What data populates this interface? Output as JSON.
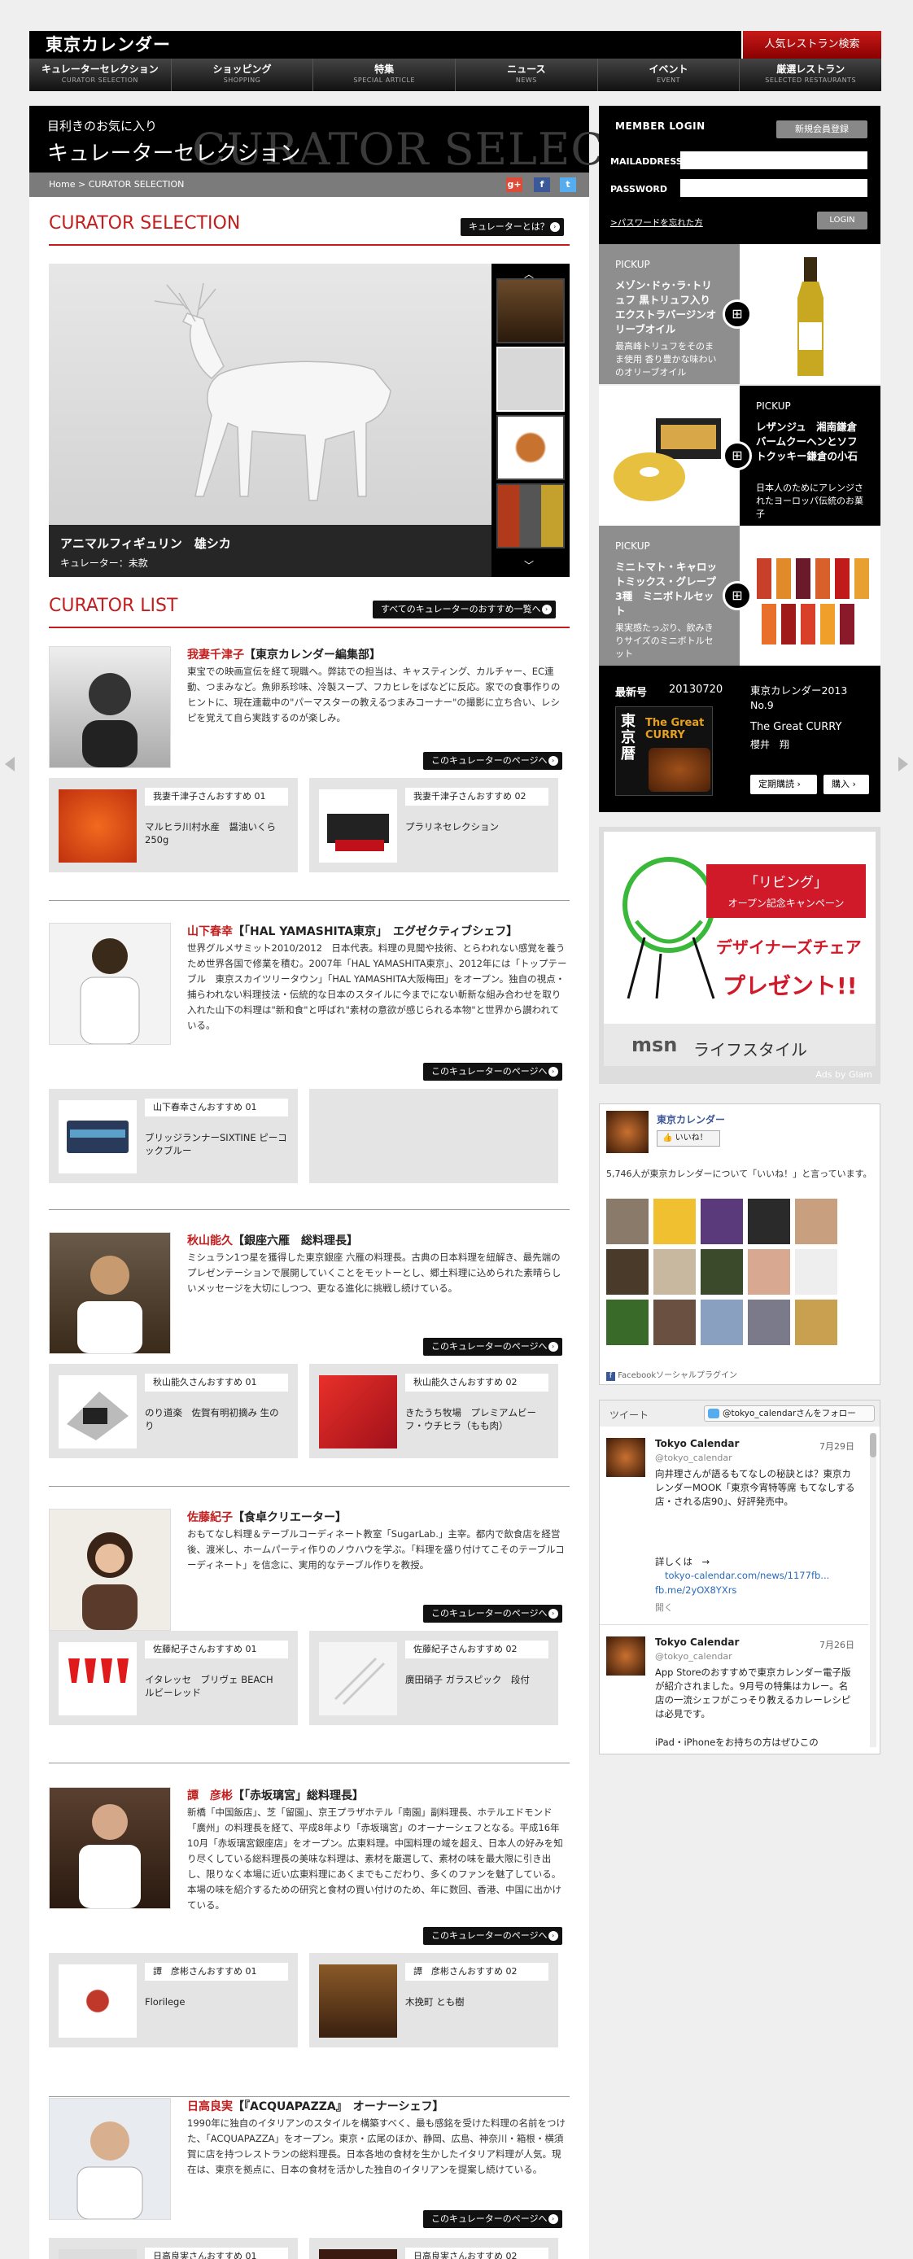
{
  "header": {
    "brand": "東京カレンダー",
    "restaurant_search": "人気レストラン検索"
  },
  "nav": [
    {
      "jp": "キュレーターセレクション",
      "en": "CURATOR SELECTION"
    },
    {
      "jp": "ショッピング",
      "en": "SHOPPING"
    },
    {
      "jp": "特集",
      "en": "SPECIAL ARTICLE"
    },
    {
      "jp": "ニュース",
      "en": "NEWS"
    },
    {
      "jp": "イベント",
      "en": "EVENT"
    },
    {
      "jp": "厳選レストラン",
      "en": "SELECTED RESTAURANTS"
    }
  ],
  "hero": {
    "sub": "目利きのお気に入り",
    "title": "キュレーターセレクション",
    "bg": "CURATOR SELECTION",
    "breadcrumb": "Home > CURATOR SELECTION"
  },
  "section1": {
    "title": "CURATOR SELECTION",
    "button": "キュレーターとは？"
  },
  "slide": {
    "name": "アニマルフィギュリン　雄シカ",
    "curator": "キュレーター：未款"
  },
  "section2": {
    "title": "CURATOR LIST",
    "button": "すべてのキュレーターのおすすめ一覧へ"
  },
  "curator_page_button": "このキュレーターのページへ",
  "curators": [
    {
      "name": "我妻千津子",
      "role": "【東京カレンダー編集部】",
      "bio": "東宝での映画宣伝を経て現職へ。弊誌での担当は、キャスティング、カルチャー、EC連動、つまみなど。魚卵系珍味、冷製スープ、フカヒレをばなどに反応。家での食事作りのヒントに、現在連載中の\"パーマスターの教えるつまみコーナー\"の撮影に立ち合い、レシピを覚えて自ら実践するのが楽しみ。",
      "recs": [
        {
          "tag": "我妻千津子さんおすすめ 01",
          "title": "マルヒラ川村水産　醤油いくら　250g"
        },
        {
          "tag": "我妻千津子さんおすすめ 02",
          "title": "プラリネセレクション"
        }
      ]
    },
    {
      "name": "山下春幸",
      "role": "【「HAL YAMASHITA東京」　エグゼクティブシェフ】",
      "bio": "世界グルメサミット2010/2012　日本代表。料理の見聞や技術、とらわれない感覚を養うため世界各国で修業を積む。2007年「HAL YAMASHITA東京」、2012年には「トップテーブル　東京スカイツリータウン」「HAL YAMASHITA大阪梅田」をオープン。独自の視点・捕らわれない料理技法・伝統的な日本のスタイルに今までにない斬新な組み合わせを取り入れた山下の料理は\"新和食\"と呼ばれ\"素材の意欲が感じられる本物\"と世界から讃われている。",
      "recs": [
        {
          "tag": "山下春幸さんおすすめ 01",
          "title": "ブリッジランナーSIXTINE ピーコックブルー"
        }
      ]
    },
    {
      "name": "秋山能久",
      "role": "【銀座六雁　総料理長】",
      "bio": "ミシュラン1つ星を獲得した東京銀座 六雁の料理長。古典の日本料理を紐解き、最先端のプレゼンテーションで展開していくことをモットーとし、郷土料理に込められた素晴らしいメッセージを大切にしつつ、更なる進化に挑戦し続けている。",
      "recs": [
        {
          "tag": "秋山能久さんおすすめ 01",
          "title": "のり道楽　佐賀有明初摘み 生のり"
        },
        {
          "tag": "秋山能久さんおすすめ 02",
          "title": "きたうち牧場　プレミアムビーフ・ウチヒラ（もも肉）"
        }
      ]
    },
    {
      "name": "佐藤紀子",
      "role": "【食卓クリエーター】",
      "bio": "おもてなし料理＆テーブルコーディネート教室「SugarLab.」主宰。都内で飲食店を経営後、渡米し、ホームパーティ作りのノウハウを学ぶ。「料理を盛り付けてこそのテーブルコーディネート」を信念に、実用的なテーブル作りを教授。",
      "recs": [
        {
          "tag": "佐藤紀子さんおすすめ 01",
          "title": "イタレッセ　ブリヴェ BEACH　ルビーレッド"
        },
        {
          "tag": "佐藤紀子さんおすすめ 02",
          "title": "廣田硝子 ガラスピック　段付"
        }
      ]
    },
    {
      "name": "譚　彦彬",
      "role": "【「赤坂璃宮」総料理長】",
      "bio": "新橋「中国飯店」、芝「留園」、京王プラザホテル「南園」副料理長、ホテルエドモンド「廣州」の料理長を経て、平成8年より「赤坂璃宮」のオーナーシェフとなる。平成16年10月「赤坂璃宮銀座店」をオープン。広東料理。中国料理の域を超え、日本人の好みを知り尽くしている総料理長の美味な料理は、素材を厳選して、素材の味を最大限に引き出し、限りなく本場に近い広東料理にあくまでもこだわり、多くのファンを魅了している。本場の味を紹介するための研究と食材の買い付けのため、年に数回、香港、中国に出かけている。",
      "recs": [
        {
          "tag": "譚　彦彬さんおすすめ 01",
          "title": "Florilege"
        },
        {
          "tag": "譚　彦彬さんおすすめ 02",
          "title": "木挽町 とも樹"
        }
      ]
    },
    {
      "name": "日高良実",
      "role": "【『ACQUAPAZZA』　オーナーシェフ】",
      "bio": "1990年に独自のイタリアンのスタイルを構築すべく、最も感銘を受けた料理の名前をつけた、「ACQUAPAZZA」をオープン。東京・広尾のほか、静岡、広島、神奈川・箱根・横須賀に店を持つレストランの総料理長。日本各地の食材を生かしたイタリア料理が人気。現在は、東京を拠点に、日本の食材を活かした独自のイタリアンを提案し続けている。",
      "recs": [
        {
          "tag": "日高良実さんおすすめ 01",
          "title": ""
        },
        {
          "tag": "日高良実さんおすすめ 02",
          "title": ""
        }
      ]
    }
  ],
  "login": {
    "title": "MEMBER LOGIN",
    "register": "新規会員登録",
    "mail": "MAILADDRESS",
    "password": "PASSWORD",
    "forgot": ">パスワードを忘れた方",
    "login_btn": "LOGIN"
  },
  "picks": [
    {
      "kicker": "PICKUP",
      "title": "メゾン･ドゥ･ラ･トリュフ 黒トリュフ入りエクストラバージンオリーブオイル",
      "desc": "最高峰トリュフをそのまま使用 香り豊かな味わいのオリーブオイル"
    },
    {
      "kicker": "PICKUP",
      "title": "レザンジュ　湘南鎌倉バームクーヘンとソフトクッキー鎌倉の小石",
      "desc": "日本人のためにアレンジされたヨーロッパ伝統のお菓子"
    },
    {
      "kicker": "PICKUP",
      "title": "ミニトマト・キャロットミックス・グレープ3種　ミニボトルセット",
      "desc": "果実感たっぷり、飲みきりサイズのミニボトルセット"
    }
  ],
  "latest": {
    "label": "最新号",
    "issue": "20130720",
    "mag": "東京カレンダー2013 No.9",
    "title": "The Great CURRY",
    "editor": "櫻井　翔",
    "subscribe": "定期購読",
    "buy": "購入",
    "cover_title": "東京暦",
    "cover_sub": "The Great CURRY"
  },
  "ad": {
    "badge1": "「リビング」",
    "badge2": "オープン記念キャンペーン",
    "line1": "デザイナーズチェア",
    "line2": "プレゼント!!",
    "brand": "msn",
    "brand2": "ライフスタイル",
    "by": "Ads by Glam"
  },
  "facebook": {
    "page": "東京カレンダー",
    "like": "いいね！",
    "count_text": "5,746人が東京カレンダーについて「いいね！」と言っています。",
    "plugin": "Facebookソーシャルプラグイン"
  },
  "twitter": {
    "label": "ツイート",
    "follow": "@tokyo_calendarさんをフォロー",
    "tweets": [
      {
        "name": "Tokyo Calendar",
        "handle": "@tokyo_calendar",
        "date": "7月29日",
        "text": "向井理さんが語るもてなしの秘訣とは？東京カレンダーMOOK「東京今宵特等席 もてなしする店・される店90」、好評発売中。",
        "more": "詳しくは　→",
        "link": "tokyo-calendar.com/news/1177fb...",
        "link2": "fb.me/2yOX8YXrs",
        "open": "開く"
      },
      {
        "name": "Tokyo Calendar",
        "handle": "@tokyo_calendar",
        "date": "7月26日",
        "text": "App Storeのおすすめで東京カレンダー電子版が紹介されました。9月号の特集はカレー。名店の一流シェフがこっそり教えるカレーレシピは必見です。",
        "more": "iPad・iPhoneをお持ちの方はぜひこの"
      }
    ]
  }
}
